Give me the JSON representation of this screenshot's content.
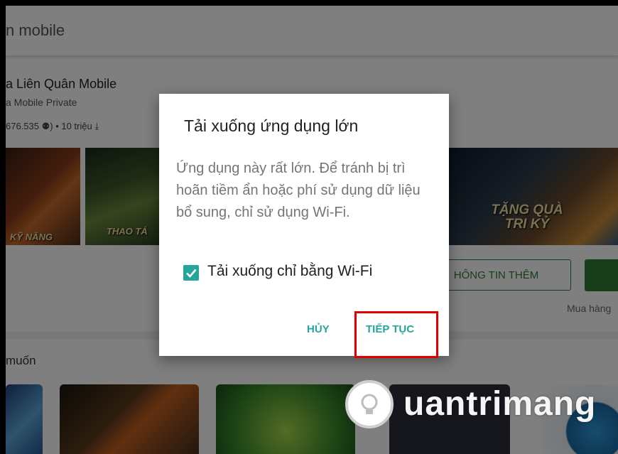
{
  "search": {
    "query": "n mobile"
  },
  "app": {
    "title": "a Liên Quân Mobile",
    "developer": "a Mobile Private",
    "meta": "676.535 ⚉) • 10 triệu ⤓"
  },
  "screenshots": [
    {
      "caption": "KỸ NĂNG"
    },
    {
      "caption": "THAO TÁ"
    },
    {
      "caption": "TẶNG QUÀ TRI KỶ"
    }
  ],
  "actions": {
    "more_info_label": "HÔNG TIN THÊM",
    "purchase_note": "Mua hàng"
  },
  "section": {
    "title": "muốn"
  },
  "dialog": {
    "title": "Tải xuống ứng dụng lớn",
    "message": "Ứng dụng này rất lớn. Để tránh bị trì hoãn tiềm ẩn hoặc phí sử dụng dữ liệu bổ sung, chỉ sử dụng Wi-Fi.",
    "checkbox_label": "Tải xuống chỉ bằng Wi-Fi",
    "checkbox_checked": true,
    "cancel_label": "HỦY",
    "continue_label": "TIẾP TỤC",
    "accent_color": "#26a69a",
    "highlight_color": "#e00000"
  },
  "watermark": {
    "text": "uantrimang"
  }
}
